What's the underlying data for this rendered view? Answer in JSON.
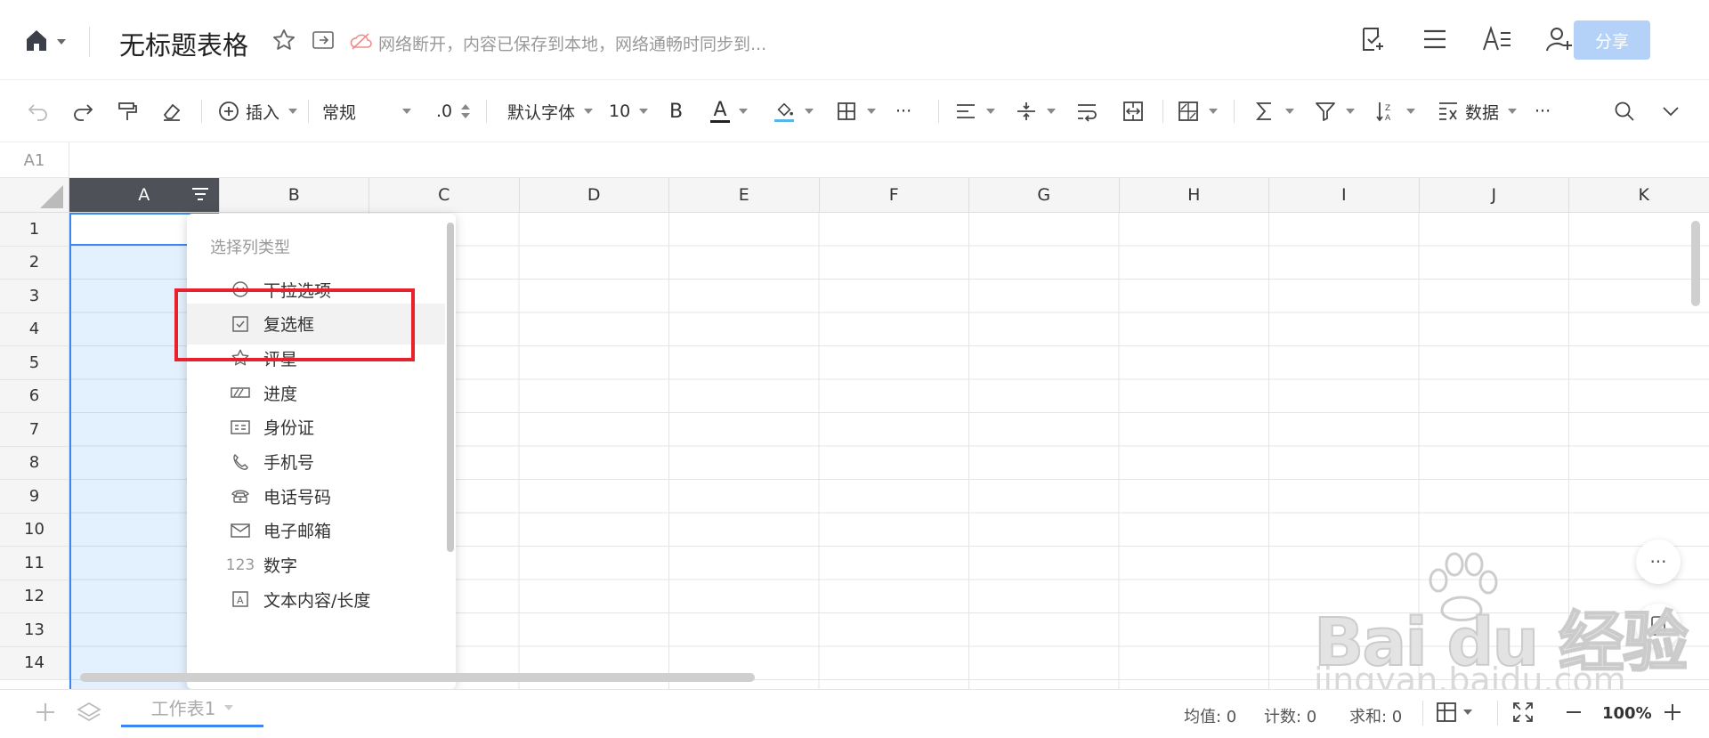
{
  "header": {
    "title": "无标题表格",
    "offline_status": "网络断开，内容已保存到本地，网络通畅时同步到...",
    "share_label": "分享",
    "icons": [
      "home-icon",
      "star-icon",
      "move-folder-icon",
      "offline-cloud-icon",
      "check-doc-icon",
      "menu-icon",
      "text-format-icon",
      "add-user-icon"
    ]
  },
  "toolbar": {
    "insert_label": "插入",
    "format_label": "常规",
    "decimal_label": ".0",
    "font_label": "默认字体",
    "fontsize_label": "10",
    "bold_label": "B",
    "data_label": "数据",
    "more_label": "···"
  },
  "formula_bar": {
    "cell_ref": "A1"
  },
  "grid": {
    "columns": [
      "A",
      "B",
      "C",
      "D",
      "E",
      "F",
      "G",
      "H",
      "I",
      "J",
      "K"
    ],
    "rows": [
      "1",
      "2",
      "3",
      "4",
      "5",
      "6",
      "7",
      "8",
      "9",
      "10",
      "11",
      "12",
      "13",
      "14"
    ],
    "selected_column": "A"
  },
  "column_type_menu": {
    "heading": "选择列类型",
    "items": [
      {
        "label": "下拉选项",
        "icon": "dropdown-circle-icon"
      },
      {
        "label": "复选框",
        "icon": "checkbox-icon"
      },
      {
        "label": "评星",
        "icon": "star-rating-icon"
      },
      {
        "label": "进度",
        "icon": "progress-icon"
      },
      {
        "label": "身份证",
        "icon": "id-card-icon"
      },
      {
        "label": "手机号",
        "icon": "mobile-phone-icon"
      },
      {
        "label": "电话号码",
        "icon": "telephone-icon"
      },
      {
        "label": "电子邮箱",
        "icon": "email-icon"
      },
      {
        "label": "数字",
        "icon": "number-icon",
        "glyph": "123"
      },
      {
        "label": "文本内容/长度",
        "icon": "text-length-icon"
      }
    ],
    "highlighted": "复选框",
    "highlight_color": "#e8222d"
  },
  "statusbar": {
    "sheet_tab": "工作表1",
    "avg_label": "均值: 0",
    "count_label": "计数: 0",
    "sum_label": "求和: 0",
    "zoom": "100%"
  },
  "watermark": {
    "brand": "Bai du 经验",
    "url": "jingyan.baidu.com"
  },
  "colors": {
    "accent": "#3b86f0",
    "selected_column_bg": "#e3f0fd",
    "share_button": "#b4d2f8"
  }
}
